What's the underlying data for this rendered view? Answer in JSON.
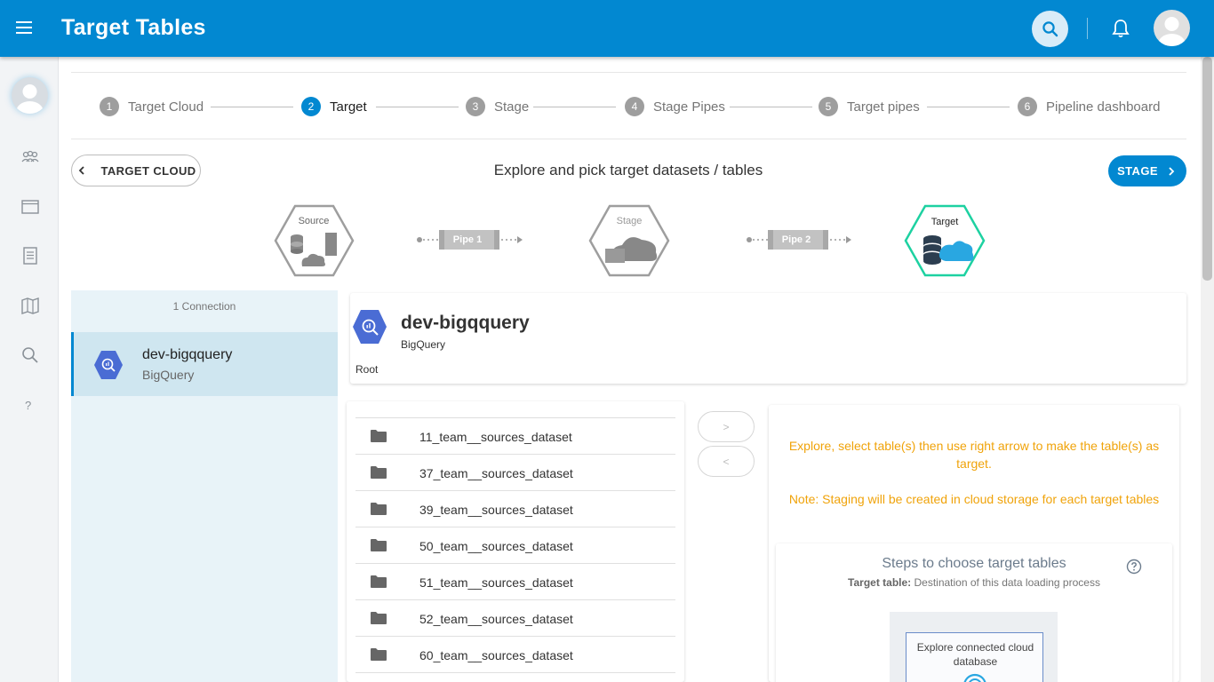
{
  "header": {
    "title": "Target Tables"
  },
  "stepper": {
    "steps": [
      {
        "num": "1",
        "label": "Target Cloud"
      },
      {
        "num": "2",
        "label": "Target"
      },
      {
        "num": "3",
        "label": "Stage"
      },
      {
        "num": "4",
        "label": "Stage Pipes"
      },
      {
        "num": "5",
        "label": "Target pipes"
      },
      {
        "num": "6",
        "label": "Pipeline dashboard"
      }
    ],
    "active_step": "2"
  },
  "toolbar": {
    "back_label": "TARGET CLOUD",
    "heading": "Explore and pick target datasets / tables",
    "next_label": "STAGE"
  },
  "flow": {
    "source_label": "Source",
    "pipe1_label": "Pipe 1",
    "stage_label": "Stage",
    "pipe2_label": "Pipe 2",
    "target_label": "Target"
  },
  "connections": {
    "count_label": "1 Connection",
    "items": [
      {
        "name": "dev-bigqquery",
        "type": "BigQuery"
      }
    ]
  },
  "detail": {
    "name": "dev-bigqquery",
    "type": "BigQuery",
    "path": "Root"
  },
  "datasets": [
    "11_team__sources_dataset",
    "37_team__sources_dataset",
    "39_team__sources_dataset",
    "50_team__sources_dataset",
    "51_team__sources_dataset",
    "52_team__sources_dataset",
    "60_team__sources_dataset"
  ],
  "transfer": {
    "right_label": ">",
    "left_label": "<"
  },
  "target_panel": {
    "hint1": "Explore, select table(s) then use right arrow to make the table(s) as target.",
    "hint2": "Note: Staging will be created in cloud storage for each target tables",
    "steps_title": "Steps to choose target tables",
    "steps_sub_bold": "Target table:",
    "steps_sub_rest": " Destination of this data loading process",
    "illus_text": "Explore connected cloud database"
  },
  "colors": {
    "primary": "#0288d1",
    "hint": "#f0a30a",
    "target_hex": "#1dd1a1"
  },
  "icons": [
    "menu-icon",
    "search-icon",
    "bell-icon",
    "user-icon",
    "team-icon",
    "window-icon",
    "document-icon",
    "map-icon",
    "help-icon",
    "folder-icon",
    "bigquery-icon"
  ]
}
